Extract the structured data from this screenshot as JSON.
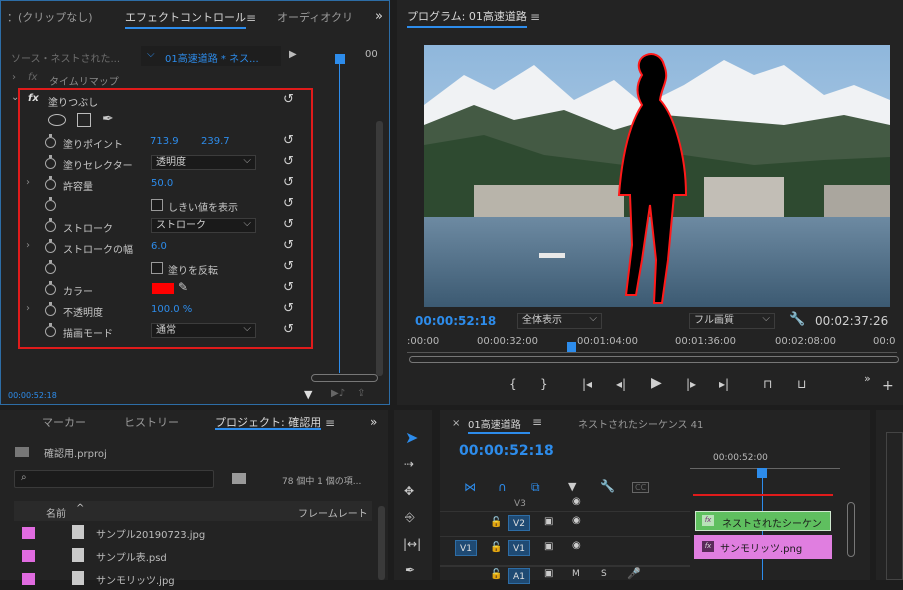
{
  "effect_controls": {
    "tabs": [
      "：(クリップなし)",
      "エフェクトコントロール",
      "オーディオクリ"
    ],
    "source_label": "ソース・ネストされた...",
    "sequence_label": "01高速道路 * ネス...",
    "time_right": "00",
    "time_remap": "タイムリマップ",
    "fx_name": "塗りつぶし",
    "props": {
      "fill_point": {
        "label": "塗りポイント",
        "x": "713.9",
        "y": "239.7"
      },
      "fill_selector": {
        "label": "塗りセレクター",
        "value": "透明度"
      },
      "tolerance": {
        "label": "許容量",
        "value": "50.0"
      },
      "show_threshold": {
        "label": "しきい値を表示"
      },
      "stroke": {
        "label": "ストローク",
        "value": "ストローク"
      },
      "stroke_width": {
        "label": "ストロークの幅",
        "value": "6.0"
      },
      "invert": {
        "label": "塗りを反転"
      },
      "color": {
        "label": "カラー",
        "swatch": "#ff0000"
      },
      "opacity": {
        "label": "不透明度",
        "value": "100.0 %"
      },
      "blend": {
        "label": "描画モード",
        "value": "通常"
      }
    },
    "timecode": "00:00:52:18"
  },
  "program": {
    "title": "プログラム: 01高速道路",
    "timecode": "00:00:52:18",
    "zoom": "全体表示",
    "quality": "フル画質",
    "duration": "00:02:37:26",
    "ruler": [
      ":00:00",
      "00:00:32:00",
      "00:01:04:00",
      "00:01:36:00",
      "00:02:08:00",
      "00:0"
    ]
  },
  "project": {
    "tabs": [
      "マーカー",
      "ヒストリー",
      "プロジェクト: 確認用"
    ],
    "file": "確認用.prproj",
    "count": "78 個中 1 個の項...",
    "col_name": "名前",
    "col_rate": "フレームレート",
    "items": [
      "サンプル20190723.jpg",
      "サンプル表.psd",
      "サンモリッツ.jpg"
    ]
  },
  "timeline": {
    "tab": "01高速道路",
    "tab2": "ネストされたシーケンス 41",
    "timecode": "00:00:52:18",
    "ruler_time": "00:00:52:00",
    "tracks": [
      "V3",
      "V2",
      "V1",
      "A1"
    ],
    "source_v1": "V1",
    "clip_nested": "ネストされたシーケン",
    "clip_png": "サンモリッツ.png",
    "colors": {
      "accent": "#2d8ceb",
      "nested_clip": "#5fbf5f",
      "png_clip": "#e07ee0",
      "highlight": "#e01b1b"
    }
  }
}
